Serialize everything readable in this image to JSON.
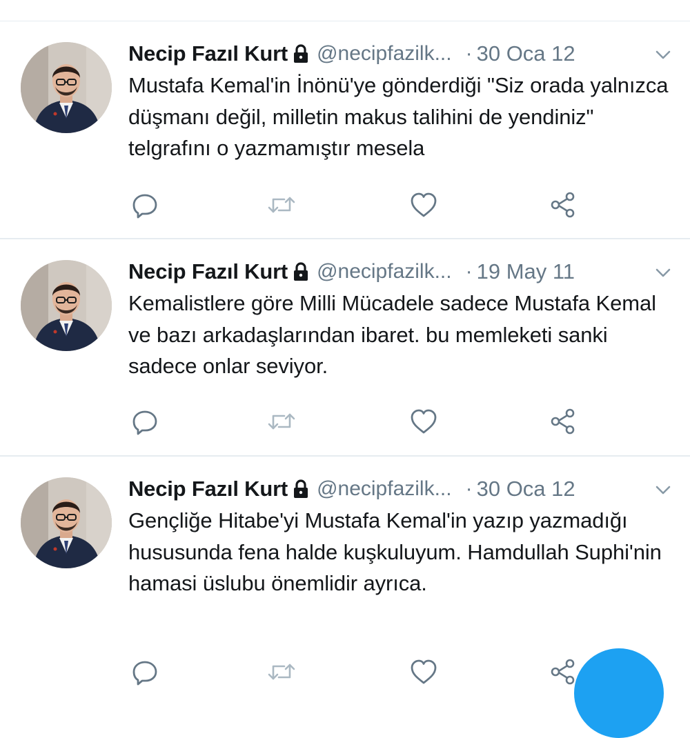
{
  "colors": {
    "accent": "#1da1f2",
    "text_primary": "#14171a",
    "text_secondary": "#657786",
    "divider": "#e6ecf0"
  },
  "tweets": [
    {
      "author_name": "Necip Fazıl Kurt",
      "handle": "@necipfazilk...",
      "separator": "·",
      "date": "30 Oca 12",
      "text": "Mustafa Kemal'in İnönü'ye gönderdiği \"Siz orada yalnızca düşmanı değil, milletin makus talihini de yendiniz\" telgrafını o yazmamıştır mesela"
    },
    {
      "author_name": "Necip Fazıl Kurt",
      "handle": "@necipfazilk...",
      "separator": "·",
      "date": "19 May 11",
      "text": "Kemalistlere göre Milli Mücadele sadece Mustafa Kemal ve bazı arkadaşlarından ibaret. bu memleketi sanki sadece onlar seviyor."
    },
    {
      "author_name": "Necip Fazıl Kurt",
      "handle": "@necipfazilk...",
      "separator": "·",
      "date": "30 Oca 12",
      "text": "Gençliğe Hitabe'yi Mustafa Kemal'in yazıp yazmadığı hususunda fena halde kuşkuluyum. Hamdullah Suphi'nin hamasi üslubu önemlidir ayrıca."
    }
  ],
  "icons": {
    "protected": "lock-icon",
    "menu": "chevron-down-icon",
    "reply": "reply-icon",
    "retweet": "retweet-icon",
    "like": "heart-icon",
    "share": "share-icon"
  }
}
